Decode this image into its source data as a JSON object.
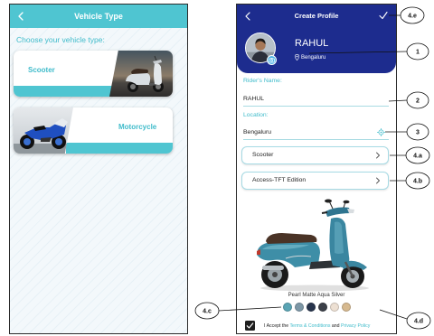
{
  "theme": {
    "teal": "#41bccb",
    "left_header": "#4fc5d1",
    "profile_header": "#1d2c8e"
  },
  "icons": {
    "back": "chevron-left-icon",
    "confirm": "check-icon",
    "location_pin": "map-pin-icon",
    "camera": "camera-icon",
    "locate": "crosshair-icon",
    "next": "chevron-right-icon"
  },
  "vehicle_type_screen": {
    "title": "Vehicle Type",
    "prompt": "Choose your vehicle type:",
    "options": [
      {
        "label": "Scooter"
      },
      {
        "label": "Motorcycle"
      }
    ]
  },
  "create_profile_screen": {
    "title": "Create Profile",
    "profile": {
      "name": "RAHUL",
      "location": "Bengaluru"
    },
    "rider_name": {
      "label": "Rider's Name:",
      "value": "RAHUL"
    },
    "location": {
      "label": "Location:",
      "value": "Bengaluru"
    },
    "vehicle_type": "Scooter",
    "vehicle_model": "Access-TFT Edition",
    "paint": {
      "selected": "Pearl Matte Aqua Silver",
      "swatches": [
        "#5aa4b4",
        "#7d97a6",
        "#27344c",
        "#3b3f48",
        "#ede0d3",
        "#d6b98f"
      ]
    },
    "consent": {
      "checked": true,
      "text_before": "I Accept the ",
      "terms_link": "Terms & Conditions",
      "text_middle": " and ",
      "privacy_link": "Privacy Policy"
    }
  },
  "callouts": [
    "4.e",
    "1",
    "2",
    "3",
    "4.a",
    "4.b",
    "4.c",
    "4.d"
  ]
}
